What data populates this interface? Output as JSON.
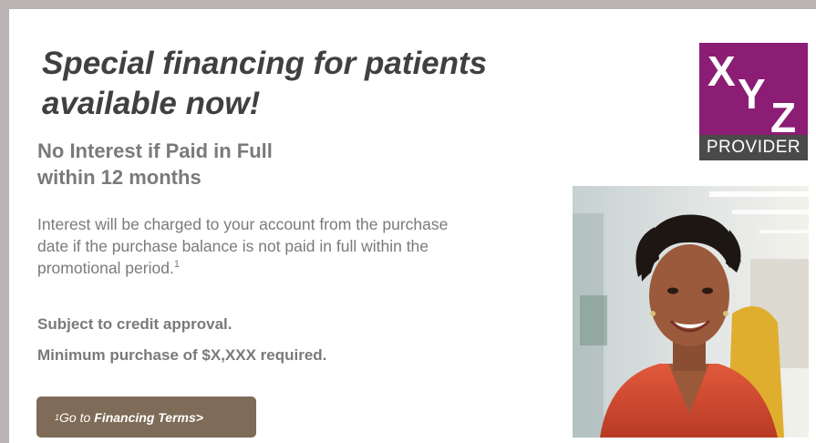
{
  "promo": {
    "headline_line1": "Special financing for patients",
    "headline_line2": "available now!",
    "subhead_line1": "No Interest if Paid in Full",
    "subhead_line2": "within 12 months",
    "body_line1": "Interest will be charged to your account from the purchase",
    "body_line2": "date if the purchase balance is not paid in full within the",
    "body_line3": "promotional period.",
    "body_footnote": "1",
    "note_credit": "Subject to credit approval.",
    "note_minimum": "Minimum purchase of $X,XXX required."
  },
  "terms_button": {
    "footnote": "1",
    "prefix": "Go to",
    "label": "Financing Terms>"
  },
  "logo": {
    "letter_x": "X",
    "letter_y": "Y",
    "letter_z": "Z",
    "badge": "PROVIDER",
    "brand_color": "#8b1d74"
  },
  "colors": {
    "headline": "#404040",
    "text": "#7a7a7a",
    "button": "#7e6c58",
    "frame": "#b9b3b3"
  },
  "photo": {
    "icon": "smiling-patient-portrait"
  }
}
